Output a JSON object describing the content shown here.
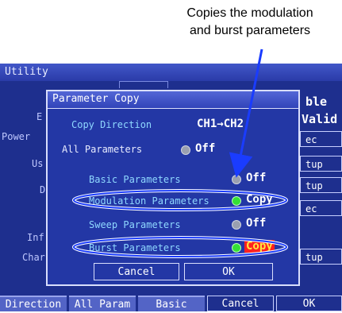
{
  "callout": {
    "line1": "Copies the modulation",
    "line2": "and burst parameters"
  },
  "window": {
    "title": "Utility"
  },
  "background": {
    "left_labels": [
      "E",
      "Power",
      "Us",
      "D",
      "Inf",
      "Char"
    ],
    "right_header": [
      "ble",
      "Valid"
    ],
    "right_boxes": [
      "ec",
      "tup",
      "tup",
      "ec",
      "tup"
    ]
  },
  "dialog": {
    "title": "Parameter Copy",
    "copy_direction": {
      "label": "Copy Direction",
      "value": "CH1→CH2"
    },
    "all_parameters": {
      "label": "All Parameters",
      "value": "Off"
    },
    "rows": [
      {
        "label": "Basic Parameters",
        "value": "Off",
        "indicator": "gray"
      },
      {
        "label": "Modulation Parameters",
        "value": "Copy",
        "indicator": "green"
      },
      {
        "label": "Sweep Parameters",
        "value": "Off",
        "indicator": "gray"
      },
      {
        "label": "Burst Parameters",
        "value": "Copy",
        "indicator": "green"
      }
    ],
    "cancel_label": "Cancel",
    "ok_label": "OK"
  },
  "function_keys": [
    "Direction",
    "All Param",
    "Basic",
    "Cancel",
    "OK"
  ],
  "colors": {
    "screen": "#1e2f8e",
    "dialog": "#2337a5",
    "highlight": "#ff2020",
    "callout_arrow": "#1a3cff"
  }
}
